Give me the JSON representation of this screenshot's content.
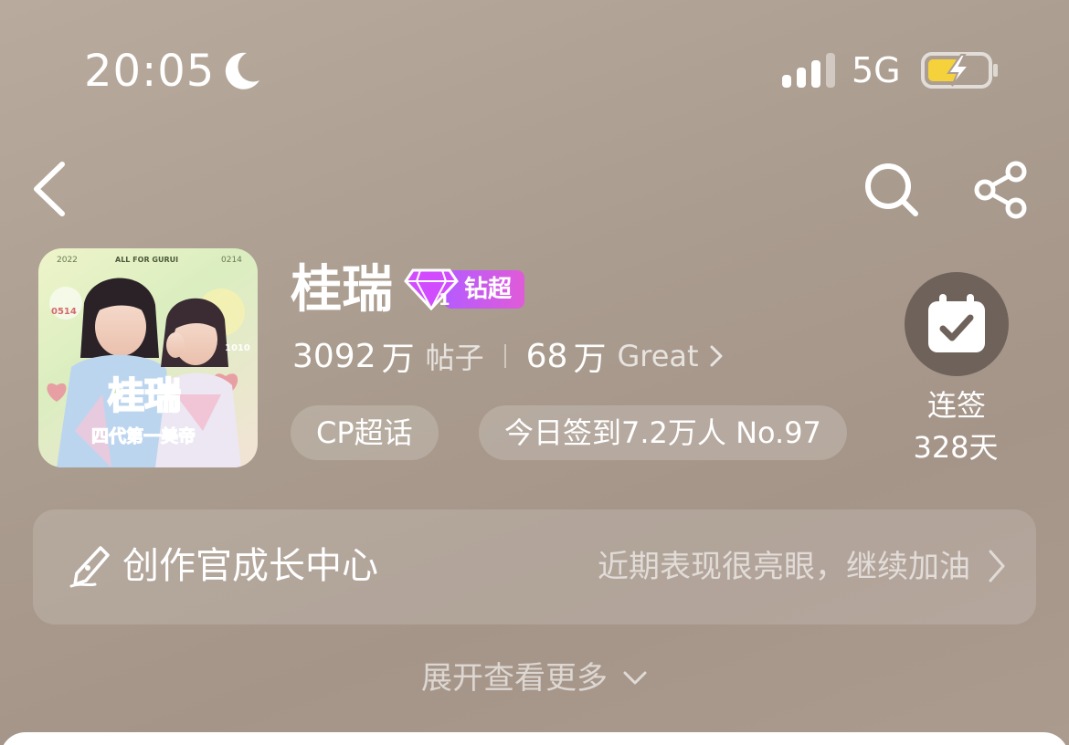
{
  "status_bar": {
    "time": "20:05",
    "network": "5G",
    "icons": [
      "moon-icon",
      "signal-icon",
      "battery-charging-icon"
    ]
  },
  "nav": {
    "icons": [
      "back-icon",
      "search-icon",
      "share-icon"
    ]
  },
  "topic": {
    "title": "桂瑞",
    "badge_label": "钻超",
    "badge_level": "1",
    "posts_count": "3092",
    "posts_unit_num": "万",
    "posts_label": "帖子",
    "fans_count": "68",
    "fans_unit_num": "万",
    "fans_label": "Great",
    "chips": {
      "type": "CP超话",
      "signin": "今日签到7.2万人 No.97"
    },
    "checkin": {
      "label": "连签",
      "days": "328天"
    },
    "cover_texts": {
      "top_left": "2022",
      "top_center": "ALL FOR GURUI",
      "top_right": "0214",
      "main": "桂瑞",
      "sub": "四代第一美帝",
      "side_left": "0514",
      "side_right": "1010"
    }
  },
  "creator_card": {
    "title": "创作官成长中心",
    "hint": "近期表现很亮眼，继续加油"
  },
  "expand": {
    "label": "展开查看更多"
  },
  "colors": {
    "background": "#ad9e92",
    "badge_gradient_start": "#b55bff",
    "badge_gradient_end": "#e05bd8",
    "checkin_circle": "#6e625a",
    "battery_fill": "#f5d23c"
  }
}
